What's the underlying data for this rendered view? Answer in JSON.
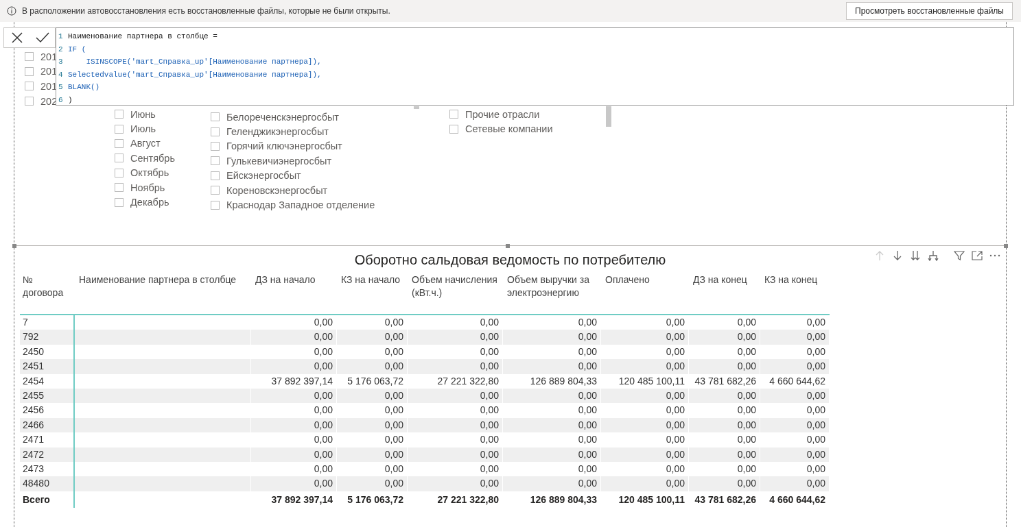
{
  "notification": {
    "message": "В расположении автовосстановления есть восстановленные файлы, которые не были открыты.",
    "button": "Просмотреть восстановленные файлы"
  },
  "formula_bar": {
    "lines": [
      {
        "number": "1",
        "code": "Наименование партнера в столбце ="
      },
      {
        "number": "2",
        "code": "IF ("
      },
      {
        "number": "3",
        "code": "    ISINSCOPE('mart_Справка_up'[Наименование партнера]),"
      },
      {
        "number": "4",
        "code": "Selectedvalue('mart_Справка_up'[Наименование партнера]),"
      },
      {
        "number": "5",
        "code": "BLANK()"
      },
      {
        "number": "6",
        "code": ")"
      }
    ]
  },
  "slicers": [
    {
      "items": [
        {
          "label": "201",
          "checked": false
        },
        {
          "label": "201",
          "checked": false
        },
        {
          "label": "201",
          "checked": false
        },
        {
          "label": "202",
          "checked": false
        }
      ]
    },
    {
      "items": [
        {
          "label": "Июнь",
          "checked": false
        },
        {
          "label": "Июль",
          "checked": false
        },
        {
          "label": "Август",
          "checked": false
        },
        {
          "label": "Сентябрь",
          "checked": false
        },
        {
          "label": "Октябрь",
          "checked": false
        },
        {
          "label": "Ноябрь",
          "checked": false
        },
        {
          "label": "Декабрь",
          "checked": false
        }
      ]
    },
    {
      "items": [
        {
          "label": "Белореченскэнергосбыт",
          "checked": false
        },
        {
          "label": "Геленджикэнергосбыт",
          "checked": false
        },
        {
          "label": "Горячий ключэнергосбыт",
          "checked": false
        },
        {
          "label": "Гулькевичиэнергосбыт",
          "checked": false
        },
        {
          "label": "Ейскэнергосбыт",
          "checked": false
        },
        {
          "label": "Кореновскэнергосбыт",
          "checked": false
        },
        {
          "label": "Краснодар Западное отделение",
          "checked": false
        }
      ]
    },
    {
      "items": [
        {
          "label": "Прочие отрасли",
          "checked": false
        },
        {
          "label": "Сетевые компании",
          "checked": false
        }
      ]
    }
  ],
  "table": {
    "title": "Оборотно сальдовая ведомость по потребителю",
    "columns": [
      "№ договора",
      "Наименование партнера в столбце",
      "ДЗ на начало",
      "КЗ на начало",
      "Объем начисления (кВт.ч.)",
      "Объем выручки за электроэнергию",
      "Оплачено",
      "ДЗ на конец",
      "КЗ на конец"
    ],
    "rows": [
      [
        "7",
        "",
        "0,00",
        "0,00",
        "0,00",
        "0,00",
        "0,00",
        "0,00",
        "0,00"
      ],
      [
        "792",
        "",
        "0,00",
        "0,00",
        "0,00",
        "0,00",
        "0,00",
        "0,00",
        "0,00"
      ],
      [
        "2450",
        "",
        "0,00",
        "0,00",
        "0,00",
        "0,00",
        "0,00",
        "0,00",
        "0,00"
      ],
      [
        "2451",
        "",
        "0,00",
        "0,00",
        "0,00",
        "0,00",
        "0,00",
        "0,00",
        "0,00"
      ],
      [
        "2454",
        "",
        "37 892 397,14",
        "5 176 063,72",
        "27 221 322,80",
        "126 889 804,33",
        "120 485 100,11",
        "43 781 682,26",
        "4 660 644,62"
      ],
      [
        "2455",
        "",
        "0,00",
        "0,00",
        "0,00",
        "0,00",
        "0,00",
        "0,00",
        "0,00"
      ],
      [
        "2456",
        "",
        "0,00",
        "0,00",
        "0,00",
        "0,00",
        "0,00",
        "0,00",
        "0,00"
      ],
      [
        "2466",
        "",
        "0,00",
        "0,00",
        "0,00",
        "0,00",
        "0,00",
        "0,00",
        "0,00"
      ],
      [
        "2471",
        "",
        "0,00",
        "0,00",
        "0,00",
        "0,00",
        "0,00",
        "0,00",
        "0,00"
      ],
      [
        "2472",
        "",
        "0,00",
        "0,00",
        "0,00",
        "0,00",
        "0,00",
        "0,00",
        "0,00"
      ],
      [
        "2473",
        "",
        "0,00",
        "0,00",
        "0,00",
        "0,00",
        "0,00",
        "0,00",
        "0,00"
      ],
      [
        "48480",
        "",
        "0,00",
        "0,00",
        "0,00",
        "0,00",
        "0,00",
        "0,00",
        "0,00"
      ]
    ],
    "total": [
      "Всего",
      "37 892 397,14",
      "5 176 063,72",
      "27 221 322,80",
      "126 889 804,33",
      "120 485 100,11",
      "43 781 682,26",
      "4 660 644,62"
    ]
  }
}
